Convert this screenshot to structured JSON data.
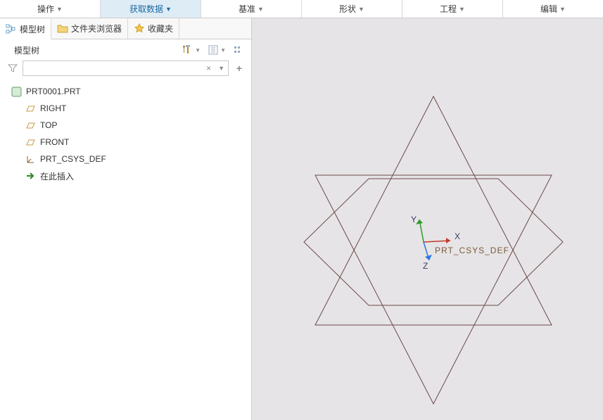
{
  "ribbon": {
    "tabs": [
      {
        "label": "操作"
      },
      {
        "label": "获取数据",
        "active": true
      },
      {
        "label": "基准"
      },
      {
        "label": "形状"
      },
      {
        "label": "工程"
      },
      {
        "label": "编辑"
      }
    ]
  },
  "side_tabs": [
    {
      "label": "模型树",
      "active": true
    },
    {
      "label": "文件夹浏览器"
    },
    {
      "label": "收藏夹"
    }
  ],
  "panel": {
    "title": "模型树"
  },
  "search": {
    "value": "",
    "placeholder": ""
  },
  "tree": {
    "root": "PRT0001.PRT",
    "items": [
      {
        "label": "RIGHT",
        "kind": "plane"
      },
      {
        "label": "TOP",
        "kind": "plane"
      },
      {
        "label": "FRONT",
        "kind": "plane"
      },
      {
        "label": "PRT_CSYS_DEF",
        "kind": "csys"
      },
      {
        "label": "在此插入",
        "kind": "insert"
      }
    ]
  },
  "canvas": {
    "axes": {
      "x": "X",
      "y": "Y",
      "z": "Z"
    },
    "csys_label": "PRT_CSYS_DEF"
  },
  "chart_data": {
    "type": "diagram",
    "description": "3D CAD viewport showing two overlapping equilateral triangles forming a six-pointed star, and one hexagon, with coordinate system gnomon at center",
    "shapes": [
      {
        "type": "triangle",
        "orientation": "up"
      },
      {
        "type": "triangle",
        "orientation": "down"
      },
      {
        "type": "hexagon"
      }
    ],
    "csys": {
      "origin_label": "PRT_CSYS_DEF",
      "axes": [
        "X",
        "Y",
        "Z"
      ]
    }
  }
}
